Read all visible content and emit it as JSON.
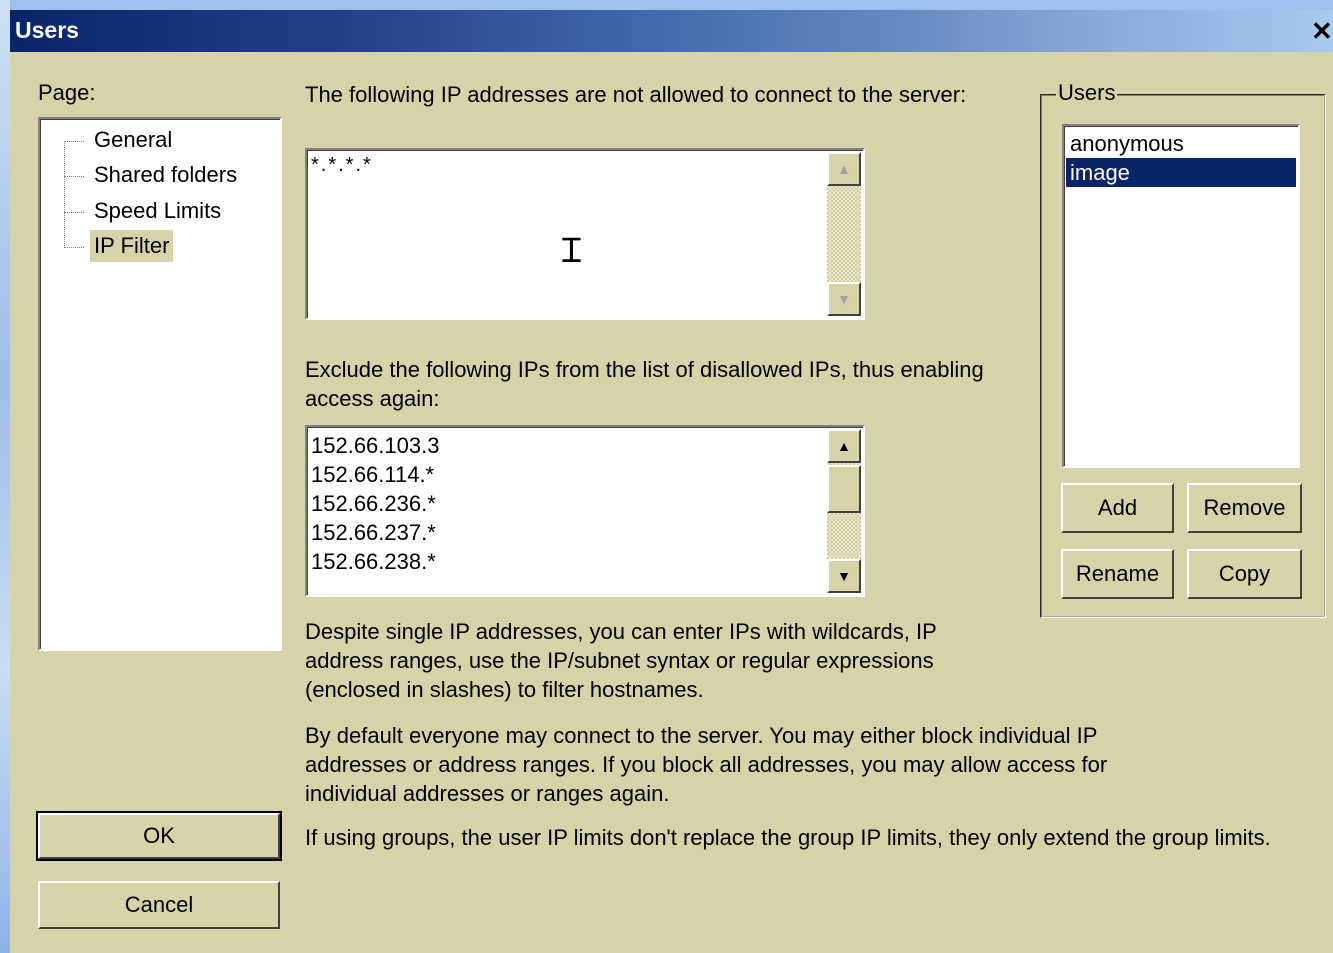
{
  "window": {
    "title": "Users",
    "close_glyph": "✕"
  },
  "page_panel": {
    "label": "Page:",
    "items": [
      {
        "label": "General",
        "selected": false
      },
      {
        "label": "Shared folders",
        "selected": false
      },
      {
        "label": "Speed Limits",
        "selected": false
      },
      {
        "label": "IP Filter",
        "selected": true
      }
    ]
  },
  "ip_filter": {
    "disallowed_label": "The following IP addresses are not allowed to connect to the server:",
    "disallowed_value": "*.*.*.*",
    "allowed_label": "Exclude the following IPs from the list of disallowed IPs, thus enabling access again:",
    "allowed_values": [
      "152.66.103.3",
      "152.66.114.*",
      "152.66.236.*",
      "152.66.237.*",
      "152.66.238.*"
    ],
    "help_1": "Despite single IP addresses, you can enter IPs with wildcards, IP address ranges, use the IP/subnet syntax or regular expressions (enclosed in slashes) to filter hostnames.",
    "help_2": "By default everyone may connect to the server. You may either block individual IP addresses or address ranges. If you block all addresses, you may allow access for individual addresses or ranges again.",
    "help_3": "If using groups, the user IP limits don't replace the group IP limits, they only extend the group limits."
  },
  "users_group": {
    "title": "Users",
    "users": [
      {
        "name": "anonymous",
        "selected": false
      },
      {
        "name": "image",
        "selected": true
      }
    ],
    "add_label": "Add",
    "remove_label": "Remove",
    "rename_label": "Rename",
    "copy_label": "Copy"
  },
  "footer": {
    "ok_label": "OK",
    "cancel_label": "Cancel"
  },
  "icons": {
    "scroll_up": "arrow-up-icon",
    "scroll_down": "arrow-down-icon",
    "text_cursor": "ibeam-cursor-icon"
  }
}
